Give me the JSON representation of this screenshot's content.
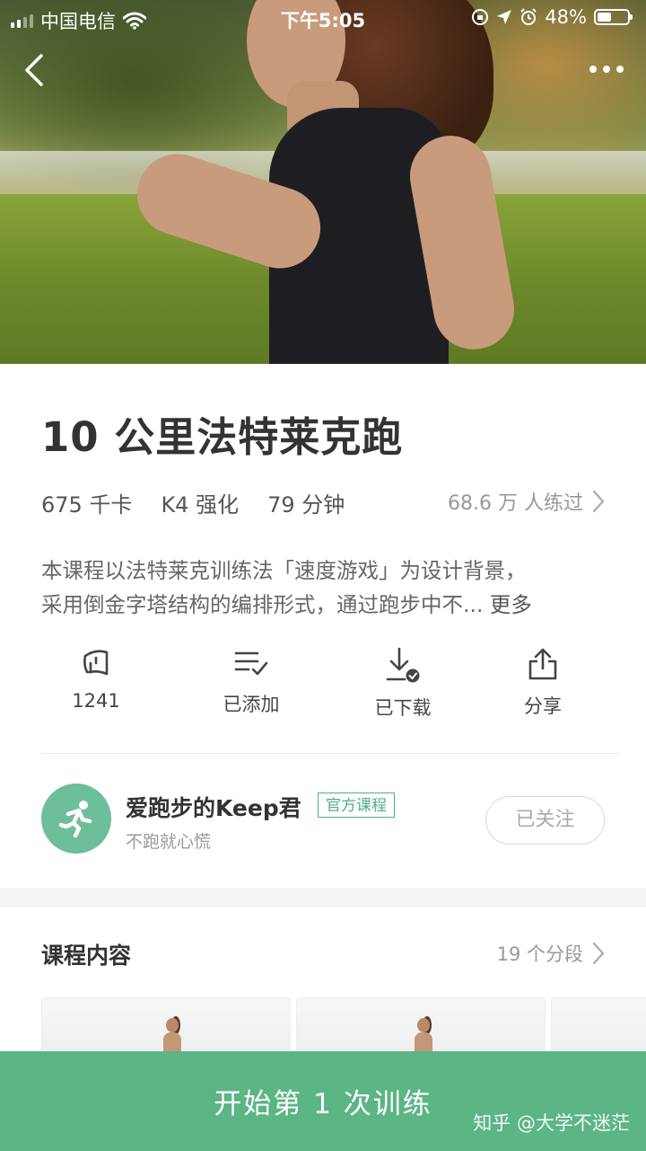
{
  "status_bar": {
    "carrier": "中国电信",
    "time": "下午5:05",
    "battery": "48%",
    "battery_level": 0.48
  },
  "course": {
    "title": "10 公里法特莱克跑",
    "calories": "675 千卡",
    "level": "K4 强化",
    "duration": "79 分钟",
    "trainees": "68.6 万 人练过",
    "description_line1": "本课程以法特莱克训练法「速度游戏」为设计背景，",
    "description_line2": "采用倒金字塔结构的编排形式，通过跑步中不...",
    "more_label": "更多"
  },
  "actions": {
    "likes": "1241",
    "added": "已添加",
    "downloaded": "已下载",
    "share": "分享"
  },
  "author": {
    "name": "爱跑步的Keep君",
    "tag": "官方课程",
    "subtitle": "不跑就心慌",
    "follow_label": "已关注",
    "avatar_color": "#6dbe9a"
  },
  "section": {
    "title": "课程内容",
    "count": "19 个分段"
  },
  "start_button": {
    "label": "开始第 1 次训练",
    "color": "#5bb585"
  },
  "watermark": "知乎 @大学不迷茫",
  "icons": {
    "back": "chevron-left-icon",
    "more": "more-dots-icon",
    "likes": "hand-wave-icon",
    "added": "list-check-icon",
    "downloaded": "download-done-icon",
    "share": "share-icon",
    "runner": "runner-icon",
    "chevron": "chevron-right-icon"
  }
}
